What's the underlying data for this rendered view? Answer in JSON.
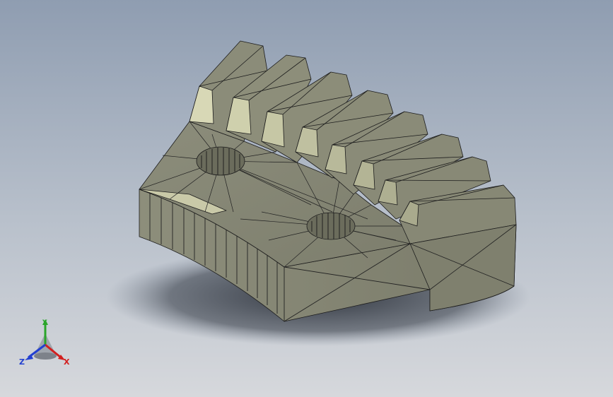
{
  "viewport": {
    "background_top": "#8f9db1",
    "background_bottom": "#d6d8dc"
  },
  "model": {
    "description_colors": {
      "face": "#8a8b78",
      "face_light": "#a8aa92",
      "face_highlight": "#d9d9b8",
      "edge": "#1c1c1c"
    }
  },
  "triad": {
    "x_label": "X",
    "y_label": "Y",
    "z_label": "Z",
    "x_color": "#d21f1f",
    "y_color": "#2aa52a",
    "z_color": "#2340d0"
  }
}
